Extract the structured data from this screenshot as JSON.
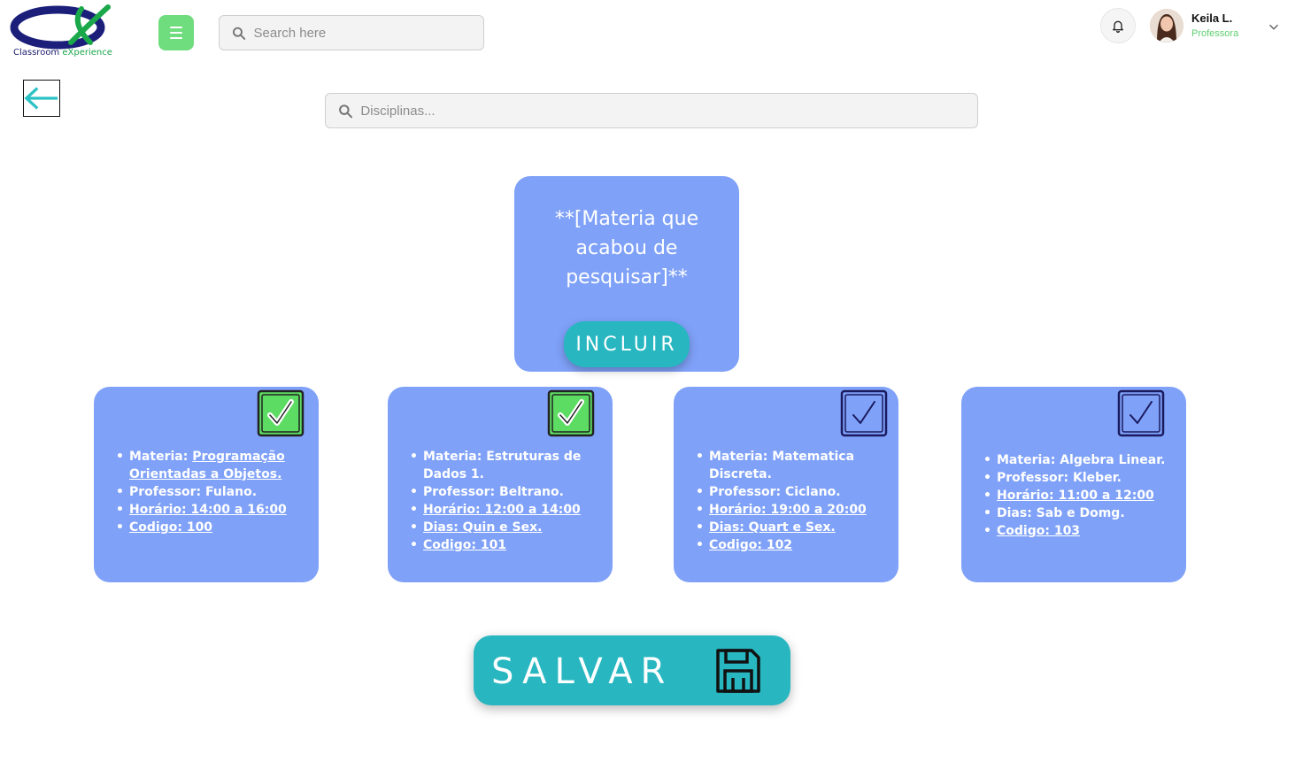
{
  "header": {
    "logo": {
      "brand_main": "Classroom",
      "brand_accent": "eXperience"
    },
    "search_placeholder": "Search here",
    "user": {
      "name": "Keila L.",
      "role": "Professora"
    }
  },
  "main": {
    "search_placeholder": "Disciplinas...",
    "highlight": {
      "text": "**[Materia que acabou de pesquisar]**",
      "include_label": "INCLUIR"
    },
    "cards": [
      {
        "checked": true,
        "items": [
          "Materia: ",
          "Professor: Fulano.",
          "Horário: 14:00 a 16:00",
          "Codigo: 100"
        ],
        "materia_link": "Programação Orientadas a Objetos."
      },
      {
        "checked": true,
        "items": [
          "Materia: Estruturas de Dados 1.",
          "Professor: Beltrano.",
          "Horário: 12:00 a 14:00",
          "Dias: Quin e Sex.",
          "Codigo: 101"
        ]
      },
      {
        "checked": false,
        "items": [
          "Materia: Matematica Discreta.",
          "Professor: Ciclano.",
          "Horário: 19:00 a 20:00",
          "Dias: Quart e Sex.",
          "Codigo: 102"
        ]
      },
      {
        "checked": false,
        "items": [
          "Materia: Algebra Linear.",
          "Professor: Kleber.",
          "Horário: 11:00 a 12:00",
          "Dias: Sab e Domg.",
          "Codigo: 103"
        ]
      }
    ],
    "save_label": "SALVAR"
  },
  "colors": {
    "card_bg": "#7fa1f8",
    "accent_teal": "#28b7c1",
    "menu_green": "#6fdc7e",
    "check_green": "#5ddc63",
    "check_dark": "#1a1a5e"
  },
  "icons": [
    "menu-icon",
    "search-icon",
    "bell-icon",
    "chevron-down-icon",
    "back-arrow-icon",
    "checkbox-icon",
    "save-icon"
  ]
}
